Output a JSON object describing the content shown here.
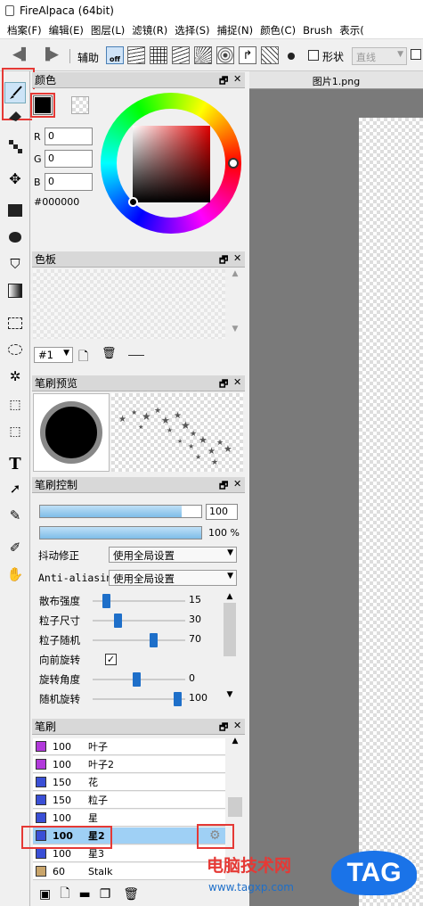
{
  "window": {
    "title": "FireAlpaca (64bit)"
  },
  "menu": [
    "档案(F)",
    "编辑(E)",
    "图层(L)",
    "滤镜(R)",
    "选择(S)",
    "捕捉(N)",
    "颜色(C)",
    "Brush",
    "表示("
  ],
  "toolbar": {
    "assist_label": "辅助",
    "off_label": "off",
    "shape_label": "形状",
    "line_option": "直线"
  },
  "color_panel": {
    "title": "颜色",
    "r_label": "R",
    "g_label": "G",
    "b_label": "B",
    "r": "0",
    "g": "0",
    "b": "0",
    "hex": "#000000",
    "current_color": "#000000"
  },
  "palette_panel": {
    "title": "色板",
    "selector": "#1"
  },
  "brush_preview_panel": {
    "title": "笔刷预览"
  },
  "brush_control_panel": {
    "title": "笔刷控制",
    "size_value": "100",
    "opacity_value": "100 %",
    "stabilizer_label": "抖动修正",
    "stabilizer_value": "使用全局设置",
    "antialias_label": "Anti-aliasin",
    "antialias_value": "使用全局设置",
    "params": [
      {
        "label": "散布强度",
        "value": "15",
        "level": 0.15
      },
      {
        "label": "粒子尺寸",
        "value": "30",
        "level": 0.28
      },
      {
        "label": "粒子随机",
        "value": "70",
        "level": 0.68
      },
      {
        "label": "向前旋转",
        "checkbox": true
      },
      {
        "label": "旋转角度",
        "value": "0",
        "level": 0.49
      },
      {
        "label": "随机旋转",
        "value": "100",
        "level": 0.95
      }
    ]
  },
  "brush_panel": {
    "title": "笔刷",
    "items": [
      {
        "size": "100",
        "name": "叶子",
        "color": "#b23adb"
      },
      {
        "size": "100",
        "name": "叶子2",
        "color": "#b23adb"
      },
      {
        "size": "150",
        "name": "花",
        "color": "#3a4fd6"
      },
      {
        "size": "150",
        "name": "粒子",
        "color": "#3a4fd6"
      },
      {
        "size": "100",
        "name": "星",
        "color": "#3a4fd6"
      },
      {
        "size": "100",
        "name": "星2",
        "color": "#3a4fd6",
        "selected": true
      },
      {
        "size": "100",
        "name": "星3",
        "color": "#3a4fd6"
      },
      {
        "size": "60",
        "name": "Stalk",
        "color": "#c9a56b"
      }
    ]
  },
  "canvas": {
    "tab_title": "图片1.png"
  },
  "watermark": {
    "site_name": "电脑技术网",
    "url": "www.tagxp.com",
    "logo": "TAG"
  },
  "colors": {
    "highlight": "#e53935",
    "selected_row": "#9fd0f5",
    "slider": "#1e6fc9"
  }
}
